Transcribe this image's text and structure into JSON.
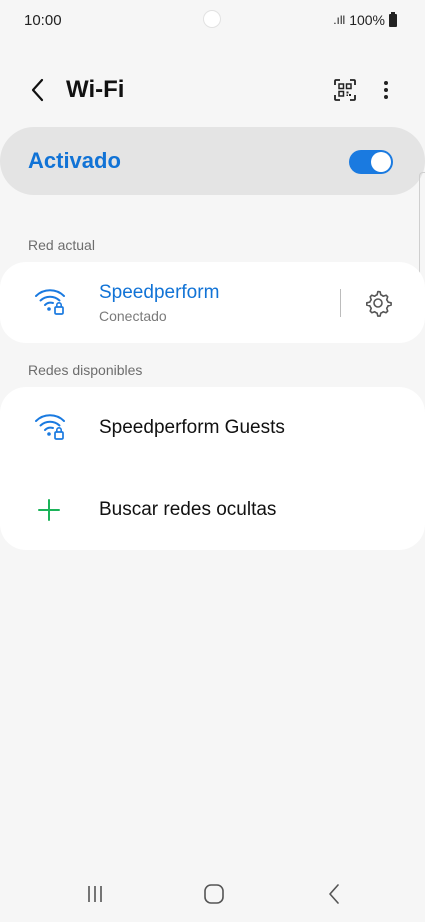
{
  "status_bar": {
    "time": "10:00",
    "signal_text": ".ıll",
    "battery_text": "100%"
  },
  "header": {
    "title": "Wi-Fi",
    "back_icon": "chevron-left-icon",
    "qr_icon": "qr-code-icon",
    "more_icon": "more-vertical-icon"
  },
  "master": {
    "label": "Activado",
    "enabled": true,
    "accent": "#1a7ae0"
  },
  "current_network": {
    "section_label": "Red actual",
    "name": "Speedperform",
    "status": "Conectado",
    "name_color": "#1173d6",
    "icon": "wifi-locked-icon",
    "settings_icon": "gear-icon"
  },
  "available": {
    "section_label": "Redes disponibles",
    "networks": [
      {
        "name": "Speedperform Guests",
        "icon": "wifi-locked-icon"
      }
    ],
    "add_hidden": {
      "label": "Buscar redes ocultas",
      "icon": "plus-icon",
      "color": "#1bb35a"
    }
  },
  "navbar": {
    "recent_icon": "recent-apps-icon",
    "home_icon": "home-icon",
    "back_icon": "back-icon"
  }
}
